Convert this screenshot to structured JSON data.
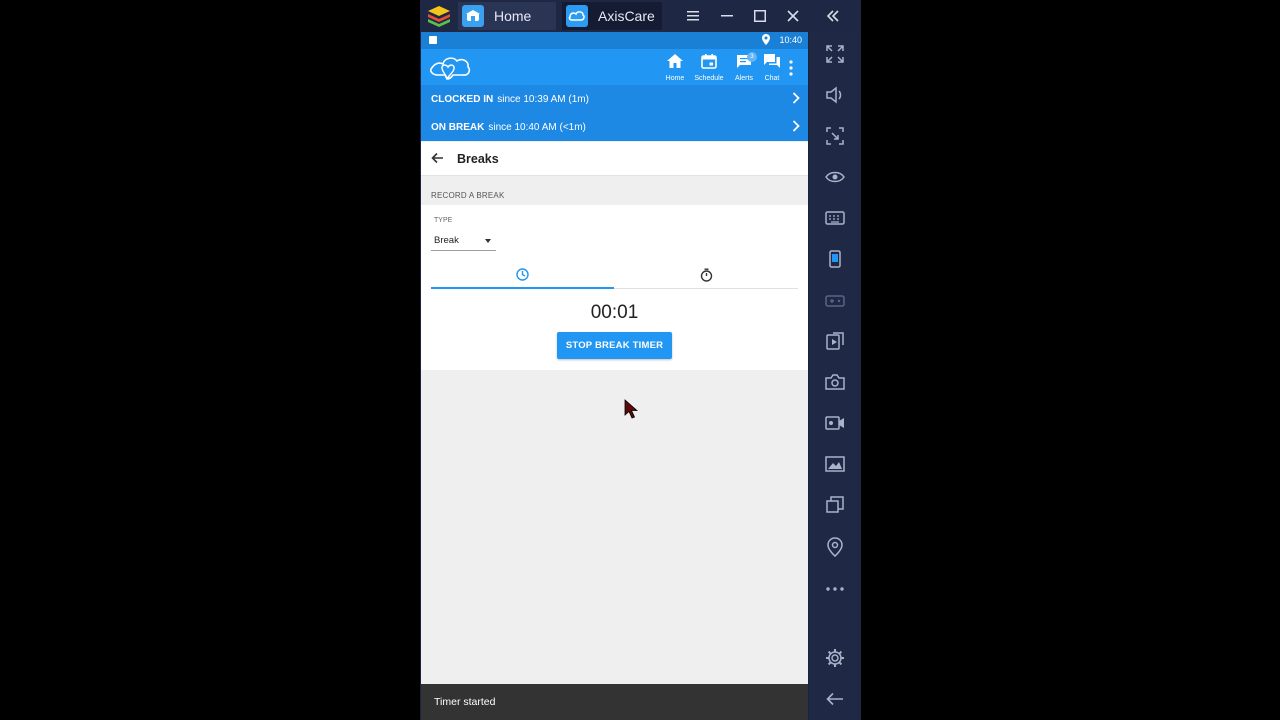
{
  "window": {
    "tabs": [
      {
        "label": "Home"
      },
      {
        "label": "AxisCare"
      }
    ]
  },
  "status": {
    "time": "10:40"
  },
  "nav": {
    "items": [
      {
        "label": "Home"
      },
      {
        "label": "Schedule"
      },
      {
        "label": "Alerts",
        "badge": "3"
      },
      {
        "label": "Chat"
      }
    ]
  },
  "banners": {
    "clocked_in": {
      "bold": "CLOCKED IN",
      "text": "since 10:39 AM (1m)"
    },
    "on_break": {
      "bold": "ON BREAK",
      "text": "since 10:40 AM (<1m)"
    }
  },
  "page": {
    "title": "Breaks",
    "section_label": "RECORD A BREAK",
    "type_label": "TYPE",
    "type_value": "Break",
    "timer": "00:01",
    "stop_button": "STOP BREAK TIMER"
  },
  "snackbar": {
    "message": "Timer started"
  },
  "colors": {
    "primary": "#2196f3",
    "banner": "#1e88e5",
    "sidebar": "#1f2845"
  }
}
